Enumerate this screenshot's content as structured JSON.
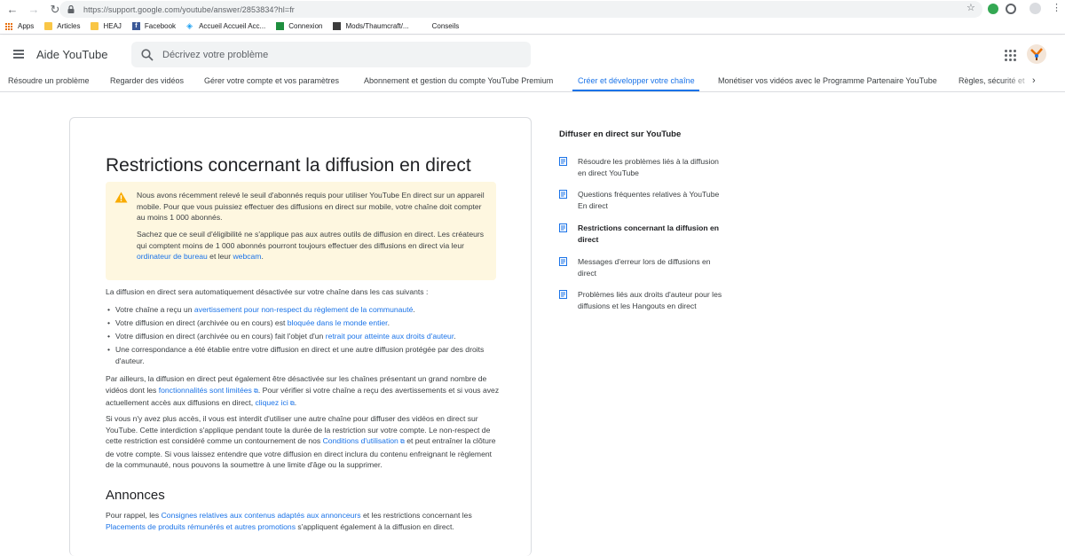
{
  "browser": {
    "url": "https://support.google.com/youtube/answer/2853834?hl=fr",
    "bookmarks": [
      "Apps",
      "Articles",
      "HEAJ",
      "Facebook",
      "Accueil Accueil Acc...",
      "Connexion",
      "Mods/Thaumcraft/...",
      "Conseils"
    ]
  },
  "header": {
    "title": "Aide YouTube",
    "search_placeholder": "Décrivez votre problème"
  },
  "tabs": [
    "Résoudre un problème",
    "Regarder des vidéos",
    "Gérer votre compte et vos paramètres",
    "Abonnement et gestion du compte YouTube Premium",
    "Créer et développer votre chaîne",
    "Monétiser vos vidéos avec le Programme Partenaire YouTube",
    "Règles, sécurité et"
  ],
  "article": {
    "title": "Restrictions concernant la diffusion en direct",
    "notice": {
      "p1": "Nous avons récemment relevé le seuil d'abonnés requis pour utiliser YouTube En direct sur un appareil mobile. Pour que vous puissiez effectuer des diffusions en direct sur mobile, votre chaîne doit compter au moins 1 000 abonnés.",
      "p2_a": "Sachez que ce seuil d'éligibilité ne s'applique pas aux autres outils de diffusion en direct. Les créateurs qui comptent moins de 1 000 abonnés pourront toujours effectuer des diffusions en direct via leur ",
      "p2_link1": "ordinateur de bureau",
      "p2_b": " et leur ",
      "p2_link2": "webcam",
      "p2_c": "."
    },
    "intro": "La diffusion en direct sera automatiquement désactivée sur votre chaîne dans les cas suivants :",
    "bullets": [
      {
        "a": "Votre chaîne a reçu un ",
        "link": "avertissement pour non-respect du règlement de la communauté",
        "b": "."
      },
      {
        "a": "Votre diffusion en direct (archivée ou en cours) est ",
        "link": "bloquée dans le monde entier",
        "b": "."
      },
      {
        "a": "Votre diffusion en direct (archivée ou en cours) fait l'objet d'un ",
        "link": "retrait pour atteinte aux droits d'auteur",
        "b": "."
      },
      {
        "a": "Une correspondance a été établie entre votre diffusion en direct et une autre diffusion protégée par des droits d'auteur.",
        "link": "",
        "b": ""
      }
    ],
    "para2": {
      "a": "Par ailleurs, la diffusion en direct peut également être désactivée sur les chaînes présentant un grand nombre de vidéos dont les ",
      "link1": "fonctionnalités sont limitées",
      "b": ". Pour vérifier si votre chaîne a reçu des avertissements et si vous avez actuellement accès aux diffusions en direct, ",
      "link2": "cliquez ici",
      "c": "."
    },
    "para3": {
      "a": "Si vous n'y avez plus accès, il vous est interdit d'utiliser une autre chaîne pour diffuser des vidéos en direct sur YouTube. Cette interdiction s'applique pendant toute la durée de la restriction sur votre compte. Le non-respect de cette restriction est considéré comme un contournement de nos ",
      "link": "Conditions d'utilisation",
      "b": " et peut entraîner la clôture de votre compte. Si vous laissez entendre que votre diffusion en direct inclura du contenu enfreignant le règlement de la communauté, nous pouvons la soumettre à une limite d'âge ou la supprimer."
    },
    "section_title": "Annonces",
    "para4": {
      "a": "Pour rappel, les ",
      "link1": "Consignes relatives aux contenus adaptés aux annonceurs",
      "b": " et les restrictions concernant les ",
      "link2": "Placements de produits rémunérés et autres promotions",
      "c": " s'appliquent également à la diffusion en direct."
    }
  },
  "sidebar": {
    "title": "Diffuser en direct sur YouTube",
    "items": [
      "Résoudre les problèmes liés à la diffusion en direct YouTube",
      "Questions fréquentes relatives à YouTube En direct",
      "Restrictions concernant la diffusion en direct",
      "Messages d'erreur lors de diffusions en direct",
      "Problèmes liés aux droits d'auteur pour les diffusions et les Hangouts en direct"
    ]
  },
  "colors": {
    "link": "#1a73e8",
    "notice_bg": "#fef7e0",
    "warning": "#f9ab00",
    "text": "#3c4043"
  }
}
